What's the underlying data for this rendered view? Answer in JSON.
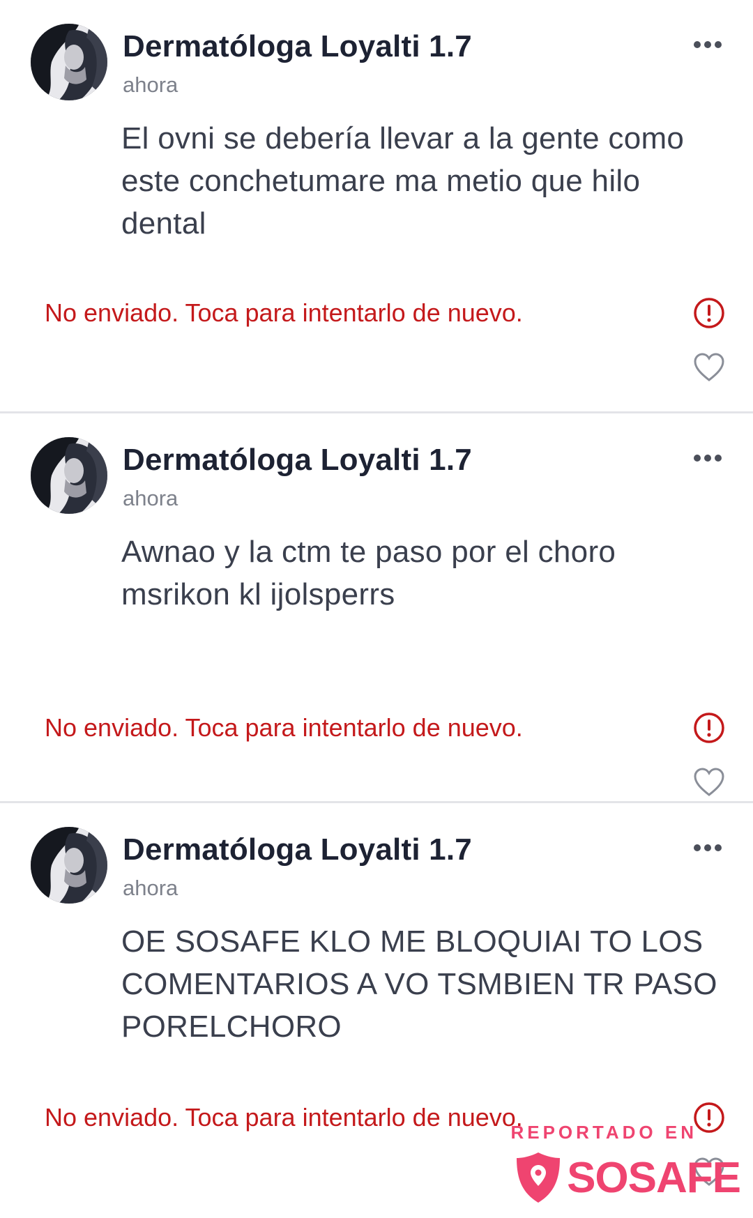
{
  "posts": [
    {
      "author": "Dermatóloga Loyalti 1.7",
      "time": "ahora",
      "text": "El ovni se debería llevar a la gente como este conchetumare ma metio que hilo dental",
      "error": "No enviado. Toca para intentarlo de nuevo."
    },
    {
      "author": "Dermatóloga Loyalti 1.7",
      "time": "ahora",
      "text": "Awnao y la ctm te paso por el choro msrikon kl ijolsperrs",
      "error": "No enviado. Toca para intentarlo de nuevo."
    },
    {
      "author": "Dermatóloga Loyalti 1.7",
      "time": "ahora",
      "text": "OE SOSAFE KLO ME BLOQUIAI TO LOS COMENTARIOS A VO TSMBIEN TR PASO PORELCHORO",
      "error": "No enviado. Toca para intentarlo de nuevo."
    }
  ],
  "icons": {
    "more": "more-options-icon",
    "alert": "alert-circle-icon",
    "like": "heart-icon",
    "brand": "sosafe-shield-logo"
  },
  "watermark": {
    "tagline": "REPORTADO EN",
    "brand": "SOSAFE"
  },
  "colors": {
    "error": "#c4191b",
    "brand": "#ef4470",
    "author": "#1d2233",
    "timestamp": "#7d818b"
  }
}
